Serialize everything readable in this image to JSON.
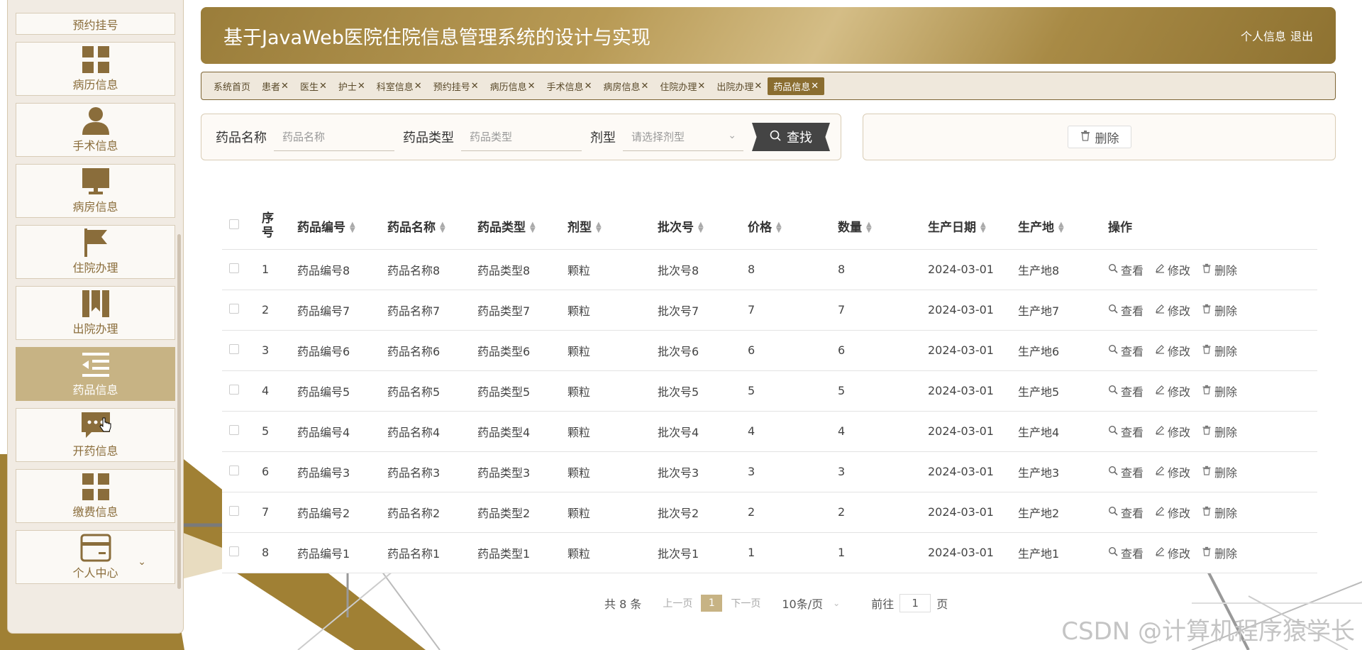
{
  "colors": {
    "brand": "#9a7d3a",
    "active": "#c7b384",
    "icon": "#8a6d3b"
  },
  "sidebar": {
    "top_label": "预约挂号",
    "items": [
      {
        "label": "病历信息",
        "icon": "grid-icon"
      },
      {
        "label": "手术信息",
        "icon": "user-icon"
      },
      {
        "label": "病房信息",
        "icon": "monitor-icon"
      },
      {
        "label": "住院办理",
        "icon": "flag-icon"
      },
      {
        "label": "出院办理",
        "icon": "bookmark-icon"
      },
      {
        "label": "药品信息",
        "icon": "indent-list-icon",
        "active": true
      },
      {
        "label": "开药信息",
        "icon": "chat-icon"
      },
      {
        "label": "缴费信息",
        "icon": "grid-icon"
      },
      {
        "label": "个人中心",
        "icon": "card-icon"
      }
    ]
  },
  "header": {
    "title": "基于JavaWeb医院住院信息管理系统的设计与实现",
    "profile": "个人信息",
    "logout": "退出"
  },
  "tabs": [
    {
      "label": "系统首页",
      "closable": false
    },
    {
      "label": "患者",
      "closable": true
    },
    {
      "label": "医生",
      "closable": true
    },
    {
      "label": "护士",
      "closable": true
    },
    {
      "label": "科室信息",
      "closable": true
    },
    {
      "label": "预约挂号",
      "closable": true
    },
    {
      "label": "病历信息",
      "closable": true
    },
    {
      "label": "手术信息",
      "closable": true
    },
    {
      "label": "病房信息",
      "closable": true
    },
    {
      "label": "住院办理",
      "closable": true
    },
    {
      "label": "出院办理",
      "closable": true
    },
    {
      "label": "药品信息",
      "closable": true,
      "active": true
    }
  ],
  "search": {
    "name_label": "药品名称",
    "name_placeholder": "药品名称",
    "type_label": "药品类型",
    "type_placeholder": "药品类型",
    "form_label": "剂型",
    "form_placeholder": "请选择剂型",
    "find_button": "查找"
  },
  "actions": {
    "delete_button": "删除"
  },
  "table": {
    "headers": [
      "序号",
      "药品编号",
      "药品名称",
      "药品类型",
      "剂型",
      "批次号",
      "价格",
      "数量",
      "生产日期",
      "生产地",
      "操作"
    ],
    "op_labels": {
      "view": "查看",
      "edit": "修改",
      "delete": "删除"
    },
    "rows": [
      [
        "1",
        "药品编号8",
        "药品名称8",
        "药品类型8",
        "颗粒",
        "批次号8",
        "8",
        "8",
        "2024-03-01",
        "生产地8"
      ],
      [
        "2",
        "药品编号7",
        "药品名称7",
        "药品类型7",
        "颗粒",
        "批次号7",
        "7",
        "7",
        "2024-03-01",
        "生产地7"
      ],
      [
        "3",
        "药品编号6",
        "药品名称6",
        "药品类型6",
        "颗粒",
        "批次号6",
        "6",
        "6",
        "2024-03-01",
        "生产地6"
      ],
      [
        "4",
        "药品编号5",
        "药品名称5",
        "药品类型5",
        "颗粒",
        "批次号5",
        "5",
        "5",
        "2024-03-01",
        "生产地5"
      ],
      [
        "5",
        "药品编号4",
        "药品名称4",
        "药品类型4",
        "颗粒",
        "批次号4",
        "4",
        "4",
        "2024-03-01",
        "生产地4"
      ],
      [
        "6",
        "药品编号3",
        "药品名称3",
        "药品类型3",
        "颗粒",
        "批次号3",
        "3",
        "3",
        "2024-03-01",
        "生产地3"
      ],
      [
        "7",
        "药品编号2",
        "药品名称2",
        "药品类型2",
        "颗粒",
        "批次号2",
        "2",
        "2",
        "2024-03-01",
        "生产地2"
      ],
      [
        "8",
        "药品编号1",
        "药品名称1",
        "药品类型1",
        "颗粒",
        "批次号1",
        "1",
        "1",
        "2024-03-01",
        "生产地1"
      ]
    ]
  },
  "pagination": {
    "total": "共 8 条",
    "prev": "上一页",
    "current": "1",
    "next": "下一页",
    "page_size": "10条/页",
    "goto_label": "前往",
    "goto_value": "1",
    "goto_suffix": "页"
  },
  "watermark": "CSDN @计算机程序猿学长"
}
